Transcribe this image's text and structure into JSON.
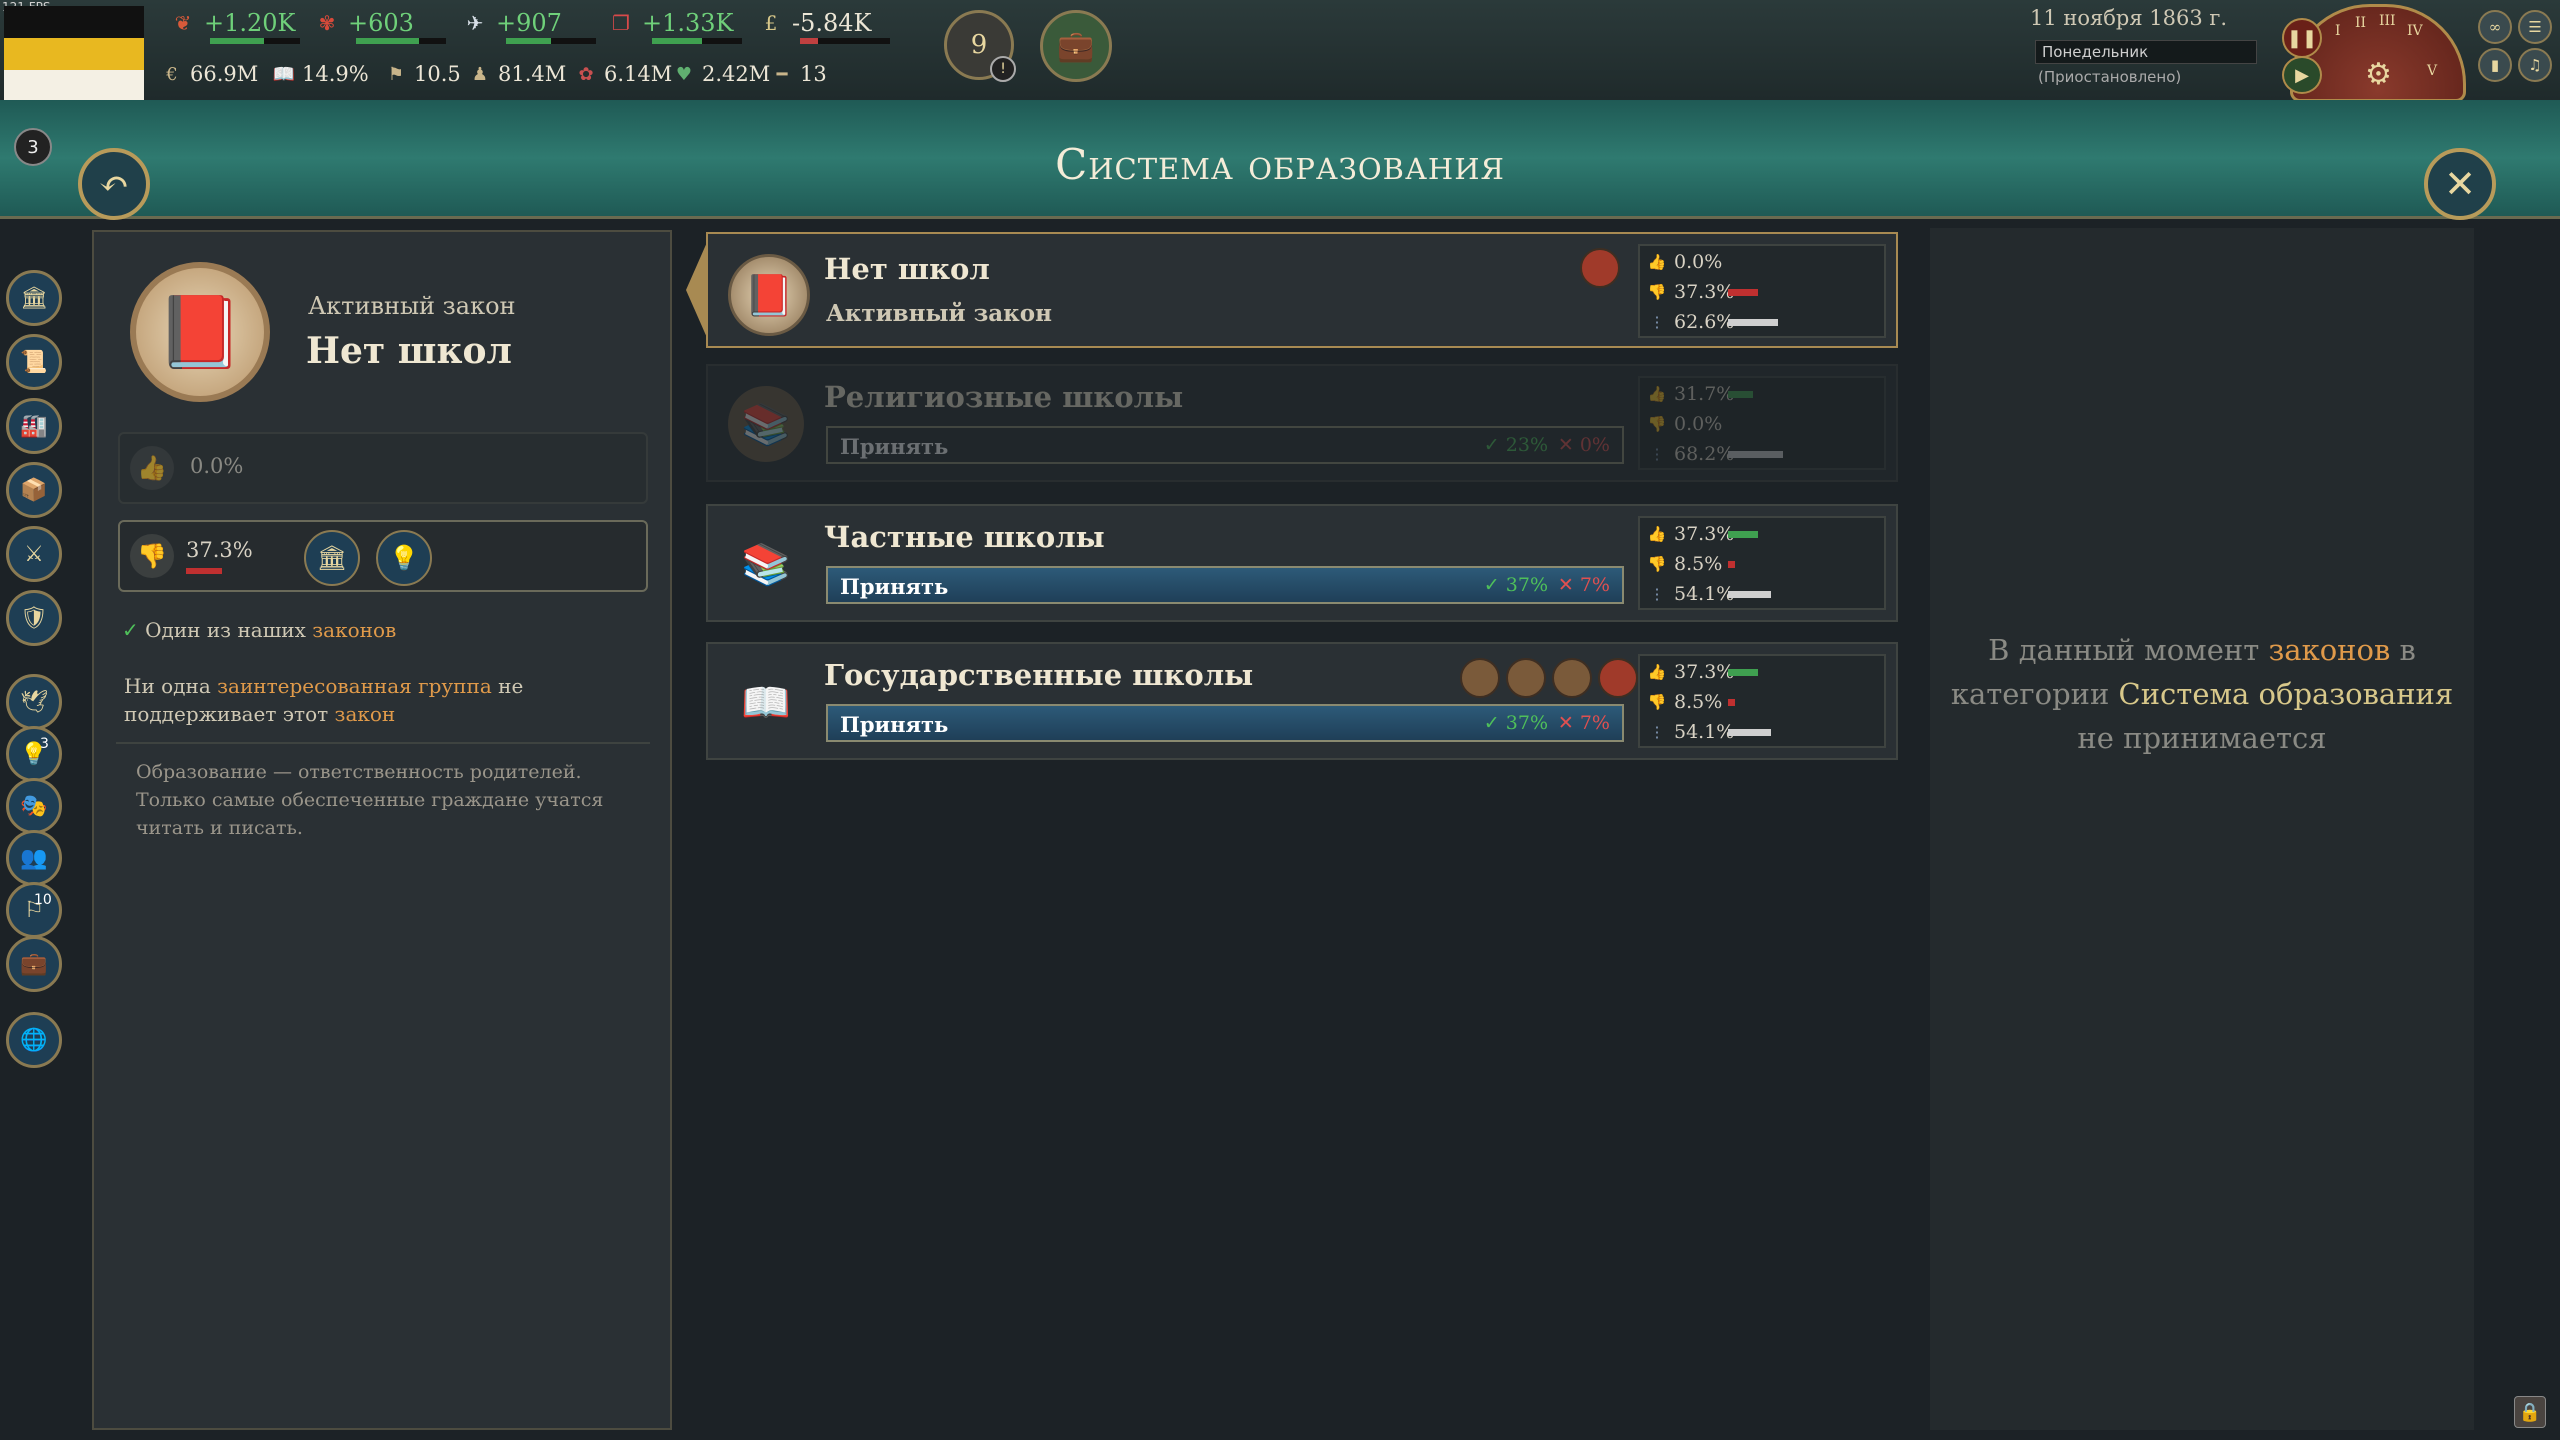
{
  "fps": "121 FPS",
  "colors": {
    "accent_gold": "#b89b5a",
    "positive": "#4fc05a",
    "negative": "#e05050",
    "header_teal": "#2f7a70"
  },
  "top_resources": [
    {
      "icon": "authority-icon",
      "value": "+1.20K",
      "fill": 0.6
    },
    {
      "icon": "bureaucracy-icon",
      "value": "+603",
      "fill": 0.7
    },
    {
      "icon": "influence-icon",
      "value": "+907",
      "fill": 0.5
    },
    {
      "icon": "innovation-icon",
      "value": "+1.33K",
      "fill": 0.55
    },
    {
      "icon": "money-icon",
      "value": "-5.84K",
      "fill": 0.2,
      "negative": true
    }
  ],
  "top_stats": [
    {
      "icon": "gdp-icon",
      "value": "66.9M"
    },
    {
      "icon": "literacy-icon",
      "value": "14.9%"
    },
    {
      "icon": "sol-icon",
      "value": "10.5"
    },
    {
      "icon": "population-icon",
      "value": "81.4M"
    },
    {
      "icon": "incorporated-population-icon",
      "value": "6.14M"
    },
    {
      "icon": "workforce-icon",
      "value": "2.42M"
    },
    {
      "icon": "army-icon",
      "value": "13"
    }
  ],
  "alerts_count": "9",
  "notification_count": "3",
  "date": {
    "line": "11 ноября 1863 г.",
    "weekday": "Понедельник",
    "status": "(Приостановлено)"
  },
  "clock_numerals": [
    "I",
    "II",
    "III",
    "IV",
    "V"
  ],
  "header": {
    "title": "Система образования"
  },
  "sidebar_badges": {
    "innovation": "3",
    "diplomacy": "10"
  },
  "active_law": {
    "label": "Активный закон",
    "name": "Нет школ",
    "support_pct": "0.0%",
    "oppose_pct": "37.3%",
    "one_of_ours_prefix": "Один из наших ",
    "one_of_ours_link": "законов",
    "no_support_a": "Ни одна ",
    "no_support_link": "заинтересованная группа",
    "no_support_b": " не поддерживает этот ",
    "no_support_link2": "закон",
    "description": "Образование — ответственность родителей. Только самые обеспеченные граждане учатся читать и писать."
  },
  "laws": [
    {
      "name": "Нет школ",
      "status": "Активный закон",
      "icon": "closed-book-icon",
      "approve": "0.0%",
      "oppose": "37.3%",
      "neutral": "62.6%",
      "approve_fill": 0,
      "oppose_fill": 0.373,
      "neutral_fill": 0.626
    },
    {
      "name": "Религиозные школы",
      "enact": "Принять",
      "yes": "23%",
      "no": "0%",
      "icon": "religious-schools-icon",
      "approve": "31.7%",
      "oppose": "0.0%",
      "neutral": "68.2%",
      "approve_fill": 0.317,
      "oppose_fill": 0,
      "neutral_fill": 0.682
    },
    {
      "name": "Частные школы",
      "enact": "Принять",
      "yes": "37%",
      "no": "7%",
      "icon": "private-schools-icon",
      "approve": "37.3%",
      "oppose": "8.5%",
      "neutral": "54.1%",
      "approve_fill": 0.373,
      "oppose_fill": 0.085,
      "neutral_fill": 0.541
    },
    {
      "name": "Государственные школы",
      "enact": "Принять",
      "yes": "37%",
      "no": "7%",
      "icon": "public-schools-icon",
      "approve": "37.3%",
      "oppose": "8.5%",
      "neutral": "54.1%",
      "approve_fill": 0.373,
      "oppose_fill": 0.085,
      "neutral_fill": 0.541
    }
  ],
  "right_panel": {
    "a": "В данный момент ",
    "link1": "законов",
    "b": " в категории ",
    "link2": "Система образования",
    "c": " не принимается"
  }
}
